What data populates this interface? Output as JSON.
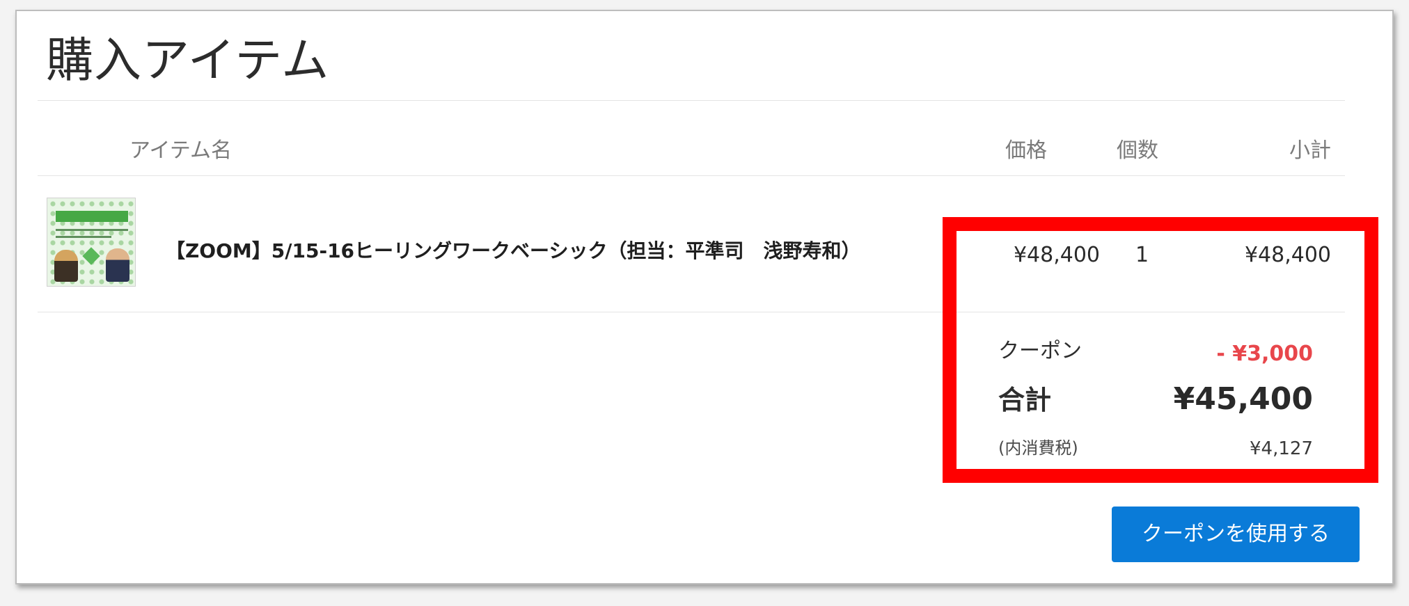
{
  "page": {
    "title": "購入アイテム"
  },
  "table": {
    "headers": {
      "item_name": "アイテム名",
      "price": "価格",
      "quantity": "個数",
      "subtotal": "小計"
    },
    "rows": [
      {
        "name": "【ZOOM】5/15-16ヒーリングワークベーシック（担当：平準司　浅野寿和）",
        "price": "¥48,400",
        "quantity": "1",
        "subtotal": "¥48,400",
        "thumbnail_icon": "product-thumbnail"
      }
    ]
  },
  "summary": {
    "coupon_label": "クーポン",
    "coupon_value": "- ¥3,000",
    "total_label": "合計",
    "total_value": "¥45,400",
    "tax_label": "(内消費税)",
    "tax_value": "¥4,127"
  },
  "actions": {
    "use_coupon_label": "クーポンを使用する"
  },
  "colors": {
    "highlight": "#ff0000",
    "discount": "#e8464b",
    "button": "#0a7bd8"
  }
}
